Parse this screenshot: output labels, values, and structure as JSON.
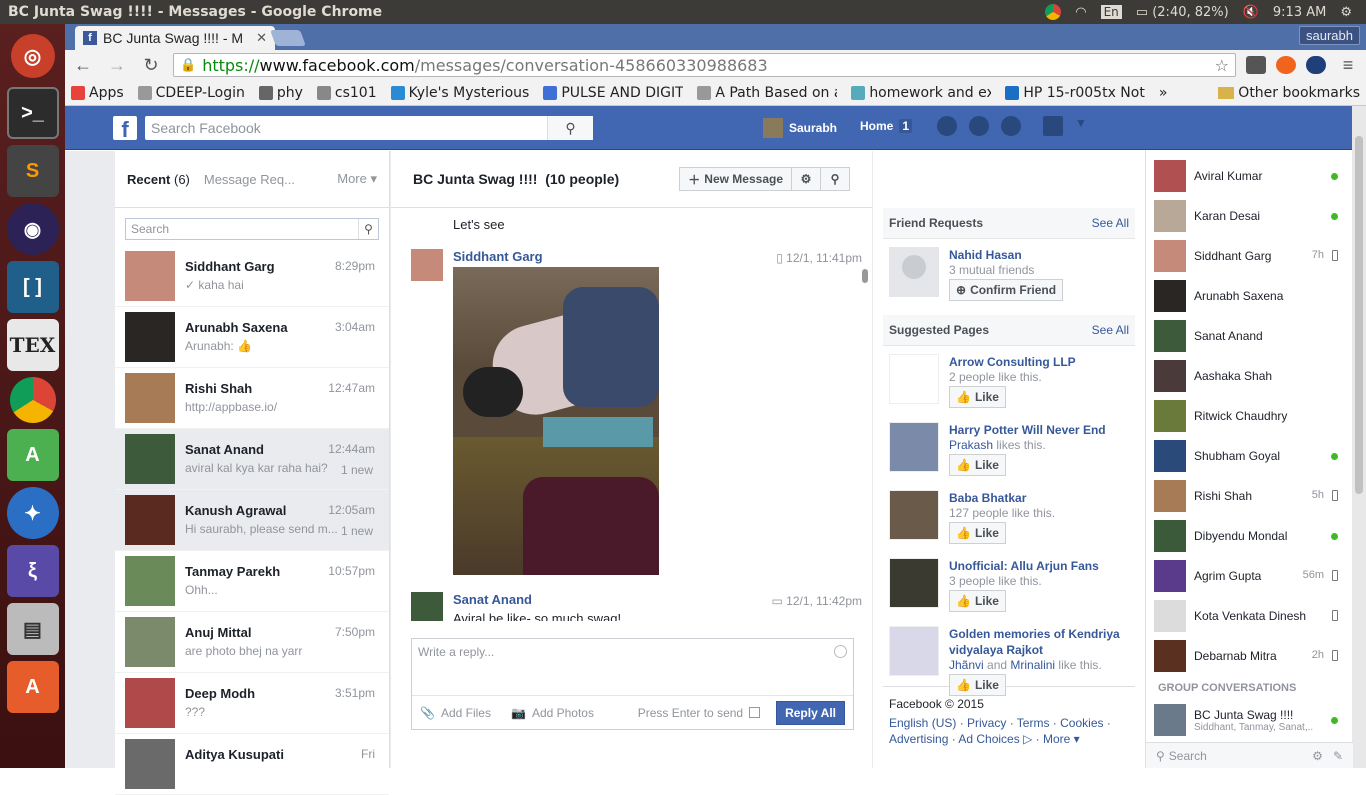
{
  "os": {
    "window_title": "BC Junta Swag !!!! - Messages - Google Chrome",
    "keyboard": "En",
    "battery": "(2:40, 82%)",
    "clock": "9:13 AM"
  },
  "browser": {
    "tab_title": "BC Junta Swag !!!! - M",
    "profile": "saurabh",
    "url_scheme": "https://",
    "url_domain": "www.facebook.com",
    "url_path": "/messages/conversation-458660330988683",
    "bookmarks": [
      {
        "label": "Apps",
        "color": "#e8433a"
      },
      {
        "label": "CDEEP-Login",
        "color": "#999"
      },
      {
        "label": "phy",
        "color": "#666"
      },
      {
        "label": "cs101",
        "color": "#888"
      },
      {
        "label": "Kyle's Mysterious",
        "color": "#2a8ad4"
      },
      {
        "label": "PULSE AND DIGIT",
        "color": "#3d6fd6"
      },
      {
        "label": "A Path Based on a",
        "color": "#999"
      },
      {
        "label": "homework and ex",
        "color": "#5ab"
      },
      {
        "label": "HP 15-r005tx Not",
        "color": "#1a6fc4"
      }
    ],
    "bookmarks_overflow": "»",
    "other_bookmarks": "Other bookmarks"
  },
  "fb": {
    "search_placeholder": "Search Facebook",
    "user": "Saurabh",
    "home": "Home",
    "home_count": "1"
  },
  "inbox": {
    "recent_label": "Recent",
    "recent_count": "(6)",
    "requests_label": "Message Req...",
    "more_label": "More ▾",
    "search_placeholder": "Search",
    "conversations": [
      {
        "name": "Siddhant Garg",
        "snippet": "✓ kaha hai",
        "time": "8:29pm",
        "new": "",
        "color": "#c58a7a",
        "selected": false
      },
      {
        "name": "Arunabh Saxena",
        "snippet": "Arunabh: 👍",
        "time": "3:04am",
        "new": "",
        "color": "#2a2624",
        "selected": false
      },
      {
        "name": "Rishi Shah",
        "snippet": "http://appbase.io/",
        "time": "12:47am",
        "new": "",
        "color": "#a67b55",
        "selected": false
      },
      {
        "name": "Sanat Anand",
        "snippet": "aviral kal kya kar raha hai?",
        "time": "12:44am",
        "new": "1 new",
        "color": "#3d5a3a",
        "selected": true
      },
      {
        "name": "Kanush Agrawal",
        "snippet": "Hi saurabh, please send m...",
        "time": "12:05am",
        "new": "1 new",
        "color": "#5a2a20",
        "selected": true
      },
      {
        "name": "Tanmay Parekh",
        "snippet": "Ohh...",
        "time": "10:57pm",
        "new": "",
        "color": "#6a8a5a",
        "selected": false
      },
      {
        "name": "Anuj Mittal",
        "snippet": "are photo bhej na yarr",
        "time": "7:50pm",
        "new": "",
        "color": "#7a8a6a",
        "selected": false
      },
      {
        "name": "Deep Modh",
        "snippet": "???",
        "time": "3:51pm",
        "new": "",
        "color": "#b04a4a",
        "selected": false
      },
      {
        "name": "Aditya Kusupati",
        "snippet": "",
        "time": "Fri",
        "new": "",
        "color": "#6a6a6a",
        "selected": false
      }
    ]
  },
  "thread": {
    "title": "BC Junta Swag !!!!",
    "people": "(10 people)",
    "new_message": "New Message",
    "msg_prev": "Let's see",
    "msg1_sender": "Siddhant Garg",
    "msg1_time": "12/1, 11:41pm",
    "msg2_sender": "Sanat Anand",
    "msg2_time": "12/1, 11:42pm",
    "msg2_text": "Aviral be like- so much swag!",
    "reply_placeholder": "Write a reply...",
    "add_files": "Add Files",
    "add_photos": "Add Photos",
    "press_enter": "Press Enter to send",
    "reply_all": "Reply All"
  },
  "side": {
    "friend_requests": "Friend Requests",
    "see_all": "See All",
    "req_name": "Nahid Hasan",
    "req_mutual": "3 mutual friends",
    "confirm": "Confirm Friend",
    "suggested": "Suggested Pages",
    "pages": [
      {
        "name": "Arrow Consulting LLP",
        "sub": "2 people like this.",
        "color": "#fff"
      },
      {
        "name": "Harry Potter Will Never End",
        "sub_link": "Prakash",
        "sub": " likes this.",
        "color": "#7a8aa8"
      },
      {
        "name": "Baba Bhatkar",
        "sub": "127 people like this.",
        "color": "#6a5a4a"
      },
      {
        "name": "Unofficial: Allu Arjun Fans",
        "sub": "3 people like this.",
        "color": "#3a3a30"
      },
      {
        "name": "Golden memories of Kendriya vidyalaya Rajkot",
        "sub_link": "Jhãnvi",
        "sub_and": " and ",
        "sub_link2": "Mrinalini",
        "sub": " like this.",
        "color": "#d8d8e8"
      }
    ],
    "like": "Like",
    "footer_copy": "Facebook © 2015",
    "footer_links": "English (US) · Privacy · Terms · Cookies · Advertising · Ad Choices ▷ · More ▾"
  },
  "chat": {
    "contacts": [
      {
        "name": "Aviral Kumar",
        "status": "online",
        "ago": "",
        "color": "#b05050"
      },
      {
        "name": "Karan Desai",
        "status": "online",
        "ago": "",
        "color": "#b8a898"
      },
      {
        "name": "Siddhant Garg",
        "status": "mobile",
        "ago": "7h",
        "color": "#c58a7a"
      },
      {
        "name": "Arunabh Saxena",
        "status": "",
        "ago": "",
        "color": "#2a2624"
      },
      {
        "name": "Sanat Anand",
        "status": "",
        "ago": "",
        "color": "#3d5a3a"
      },
      {
        "name": "Aashaka Shah",
        "status": "",
        "ago": "",
        "color": "#4a3a3a"
      },
      {
        "name": "Ritwick Chaudhry",
        "status": "",
        "ago": "",
        "color": "#6a7a3a"
      },
      {
        "name": "Shubham Goyal",
        "status": "online",
        "ago": "",
        "color": "#2a4a7a"
      },
      {
        "name": "Rishi Shah",
        "status": "mobile",
        "ago": "5h",
        "color": "#a67b55"
      },
      {
        "name": "Dibyendu Mondal",
        "status": "online",
        "ago": "",
        "color": "#3a5a3a"
      },
      {
        "name": "Agrim Gupta",
        "status": "mobile",
        "ago": "56m",
        "color": "#5a3a8a"
      },
      {
        "name": "Kota Venkata Dinesh",
        "status": "mobile",
        "ago": "",
        "color": "#dcdcdc"
      },
      {
        "name": "Debarnab Mitra",
        "status": "mobile",
        "ago": "2h",
        "color": "#5a3020"
      }
    ],
    "group_header": "GROUP CONVERSATIONS",
    "group_name": "BC Junta Swag !!!!",
    "group_members": "Siddhant, Tanmay, Sanat,...",
    "search": "Search"
  }
}
